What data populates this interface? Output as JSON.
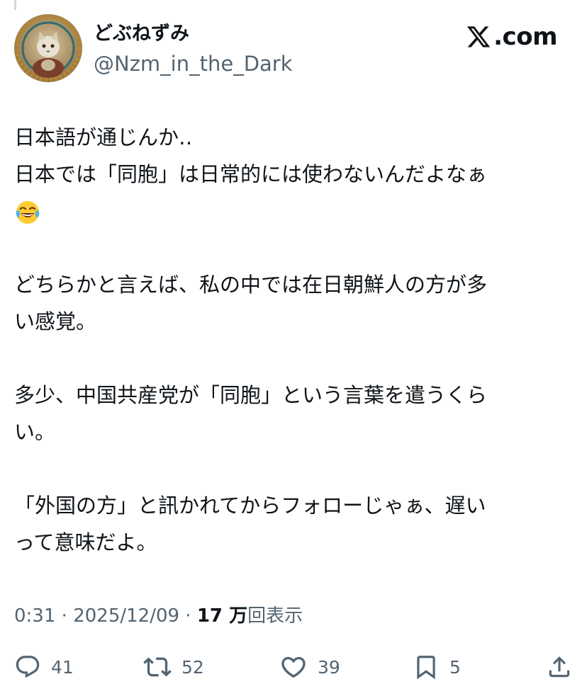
{
  "author": {
    "display_name": "どぶねずみ",
    "handle": "@Nzm_in_the_Dark"
  },
  "brand": {
    "label": ".com",
    "logo_icon": "x-logo-icon"
  },
  "tweet": {
    "paragraphs": [
      [
        "日本語が通じんか‥",
        "日本では「同胞」は日常的には使わないんだよなぁ"
      ],
      [
        "どちらかと言えば、私の中では在日朝鮮人の方が多",
        "い感覚。"
      ],
      [
        "多少、中国共産党が「同胞」という言葉を遣うくら",
        "い。"
      ],
      [
        "「外国の方」と訊かれてからフォローじゃぁ、遅い",
        "って意味だよ。"
      ]
    ],
    "emoji": "face-with-tears-of-joy"
  },
  "meta": {
    "time": "0:31",
    "separator": " · ",
    "date": "2025/12/09",
    "views_count": "17 万",
    "views_label": "回表示"
  },
  "actions": {
    "replies": "41",
    "reposts": "52",
    "likes": "39",
    "bookmarks": "5"
  },
  "colors": {
    "text": "#0f1419",
    "secondary": "#536471"
  }
}
